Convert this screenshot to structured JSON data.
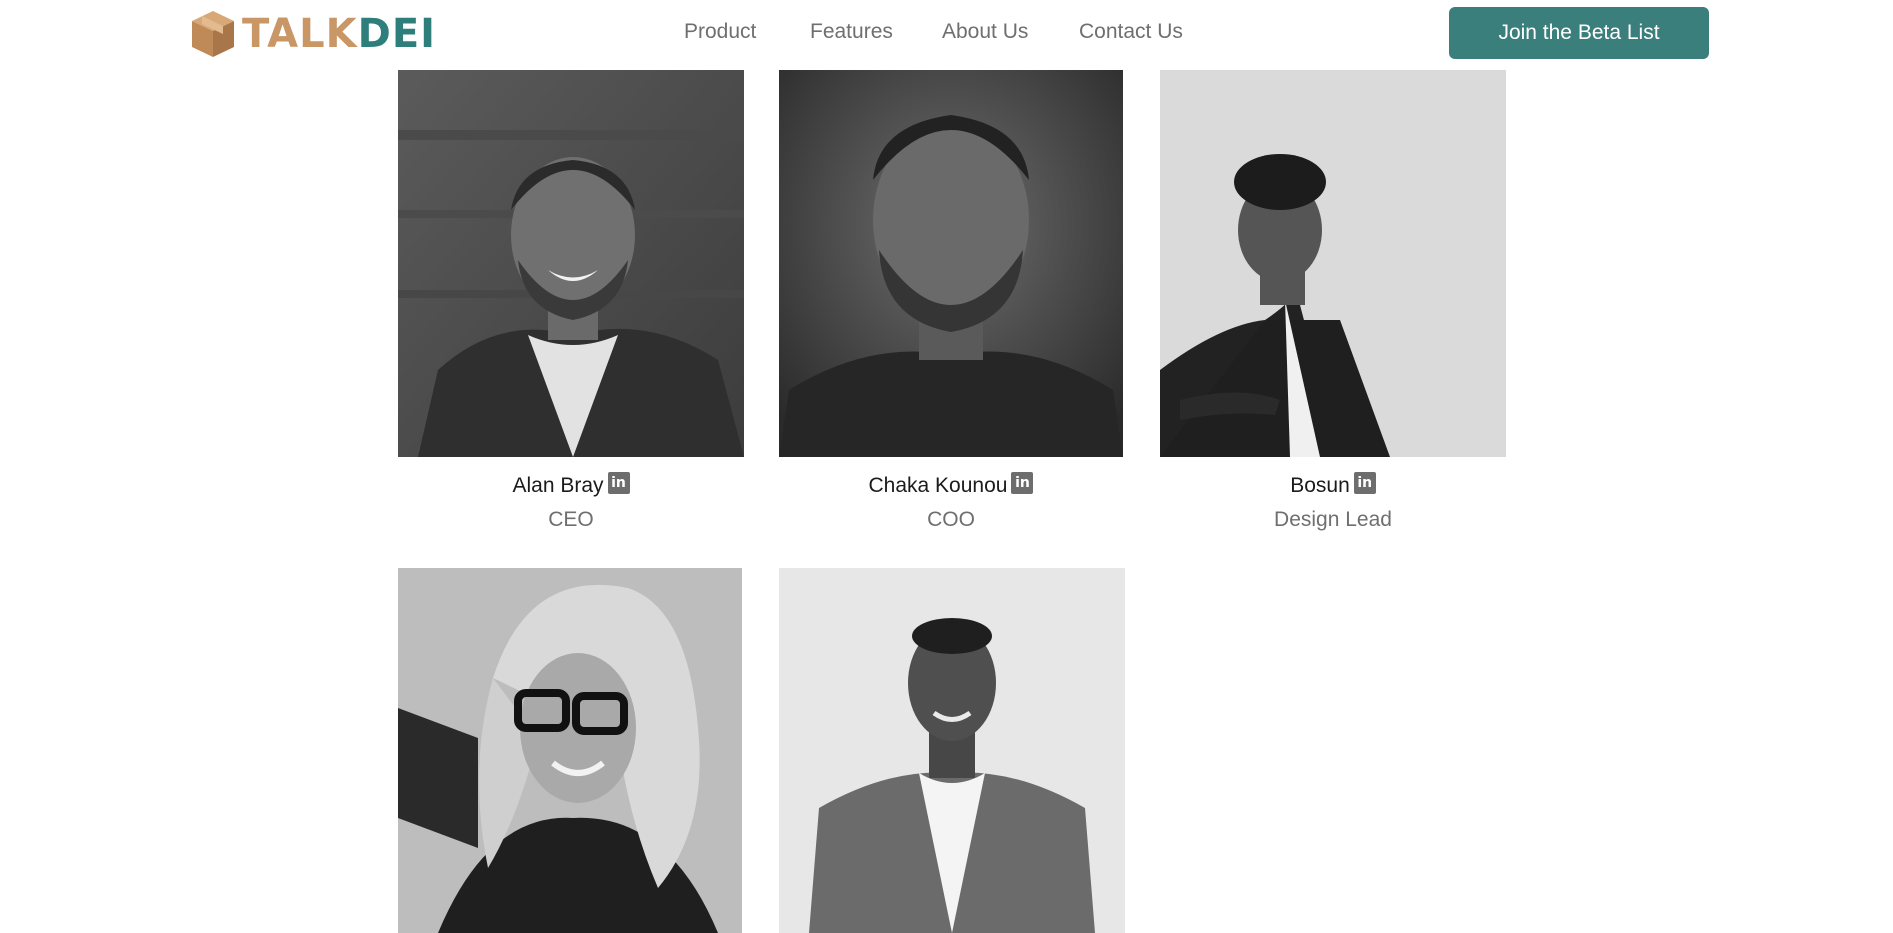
{
  "brand": {
    "part1": "TALK",
    "part2": "DEI"
  },
  "nav": [
    {
      "label": "Product"
    },
    {
      "label": "Features"
    },
    {
      "label": "About Us"
    },
    {
      "label": "Contact Us"
    }
  ],
  "cta": {
    "label": "Join the Beta List"
  },
  "team": [
    {
      "name": "Alan Bray",
      "role": "CEO",
      "icon": "linkedin-icon"
    },
    {
      "name": "Chaka Kounou",
      "role": "COO",
      "icon": "linkedin-icon"
    },
    {
      "name": "Bosun",
      "role": "Design Lead",
      "icon": "linkedin-icon"
    }
  ],
  "colors": {
    "brand_tan": "#c99666",
    "brand_teal": "#2e7f7c",
    "button": "#3a7f7c",
    "muted_text": "#6f6f6f"
  }
}
